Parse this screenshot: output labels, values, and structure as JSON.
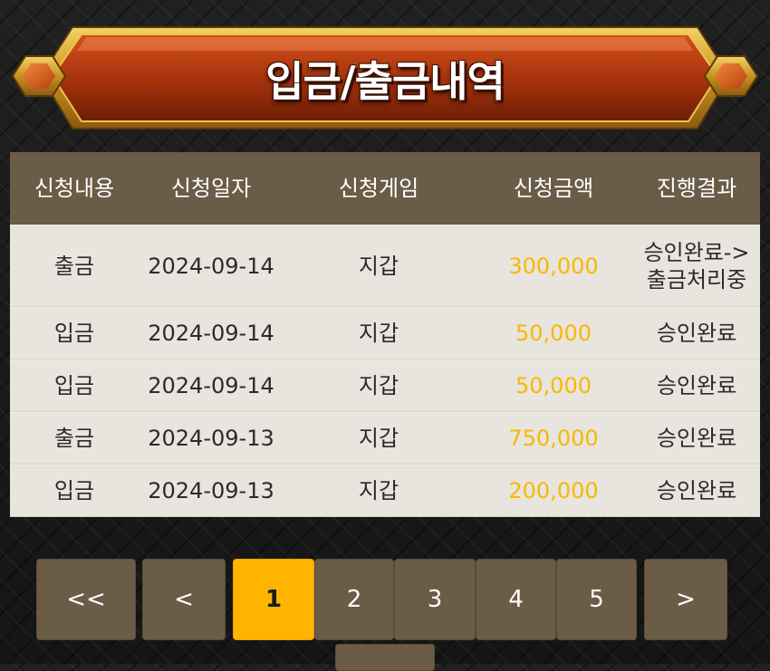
{
  "title": "입금/출금내역",
  "colors": {
    "header_bg": "#6b5c48",
    "row_bg": "#e8e4de",
    "amount": "#f9b800",
    "active_page": "#ffb400",
    "banner": "#b33a0f",
    "banner_frame": "#d9a92e"
  },
  "table": {
    "headers": [
      "신청내용",
      "신청일자",
      "신청게임",
      "신청금액",
      "진행결과"
    ],
    "rows": [
      {
        "type": "출금",
        "date": "2024-09-14",
        "game": "지갑",
        "amount": "300,000",
        "result_line1": "승인완료->",
        "result_line2": "출금처리중"
      },
      {
        "type": "입금",
        "date": "2024-09-14",
        "game": "지갑",
        "amount": "50,000",
        "result": "승인완료"
      },
      {
        "type": "입금",
        "date": "2024-09-14",
        "game": "지갑",
        "amount": "50,000",
        "result": "승인완료"
      },
      {
        "type": "출금",
        "date": "2024-09-13",
        "game": "지갑",
        "amount": "750,000",
        "result": "승인완료"
      },
      {
        "type": "입금",
        "date": "2024-09-13",
        "game": "지갑",
        "amount": "200,000",
        "result": "승인완료"
      }
    ]
  },
  "pagination": {
    "first": "<<",
    "prev": "<",
    "pages": [
      "1",
      "2",
      "3",
      "4",
      "5"
    ],
    "current": "1",
    "next": ">"
  }
}
